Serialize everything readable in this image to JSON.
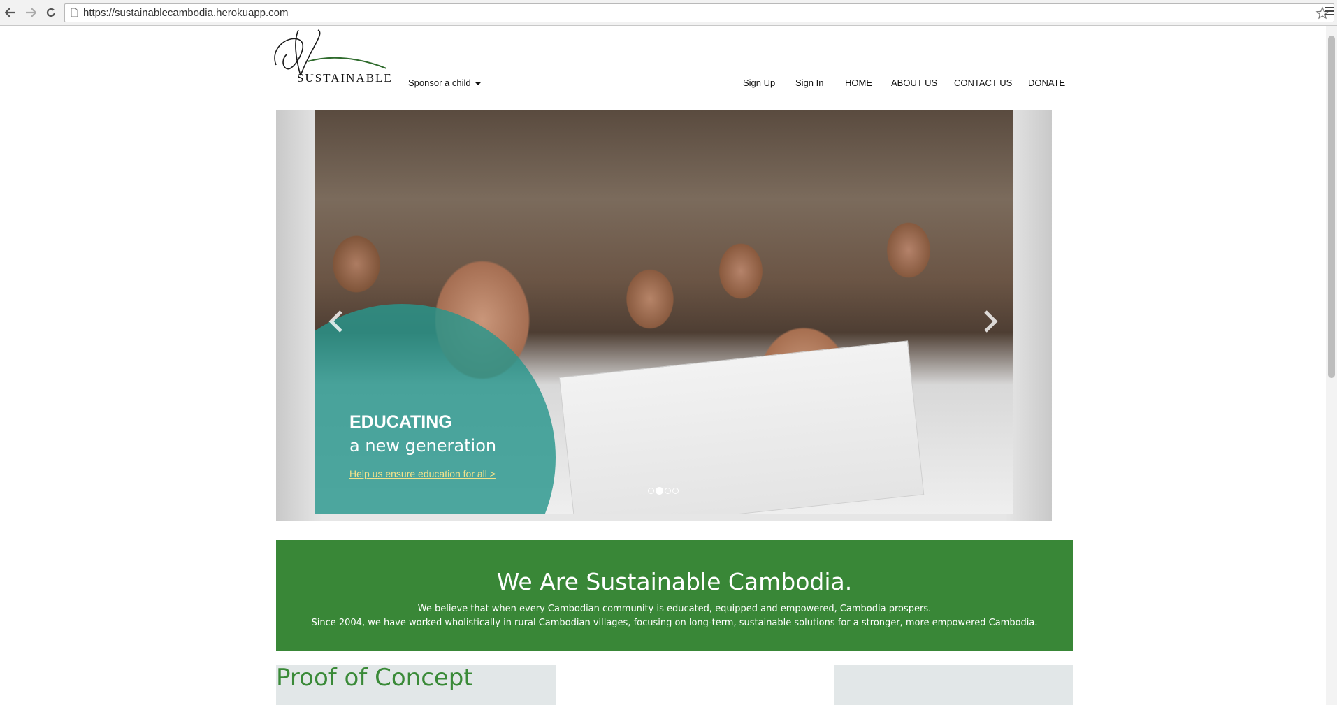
{
  "browser": {
    "url": "https://sustainablecambodia.herokuapp.com",
    "back_icon": "back-arrow-icon",
    "forward_icon": "forward-arrow-icon",
    "reload_icon": "reload-icon",
    "bookmark_icon": "star-icon",
    "menu_icon": "hamburger-menu-icon"
  },
  "header": {
    "logo_text": "SUSTAINABLE",
    "dropdown_label": "Sponsor a child",
    "nav": [
      "Sign Up",
      "Sign In",
      "HOME",
      "ABOUT US",
      "CONTACT US",
      "DONATE"
    ]
  },
  "carousel": {
    "title": "EDUCATING",
    "subtitle": "a new generation",
    "link": "Help us ensure education for all >",
    "slide_count": 4,
    "active_slide": 2,
    "accent_color": "#2a968c"
  },
  "banner": {
    "title": "We Are Sustainable Cambodia.",
    "line1": "We believe that when every Cambodian community is educated, equipped and empowered, Cambodia prospers.",
    "line2": "Since 2004, we have worked wholistically in rural Cambodian villages, focusing on long-term, sustainable solutions for a stronger, more empowered Cambodia.",
    "color": "#398737"
  },
  "section": {
    "title": "Proof of Concept",
    "color": "#3a8a38"
  }
}
